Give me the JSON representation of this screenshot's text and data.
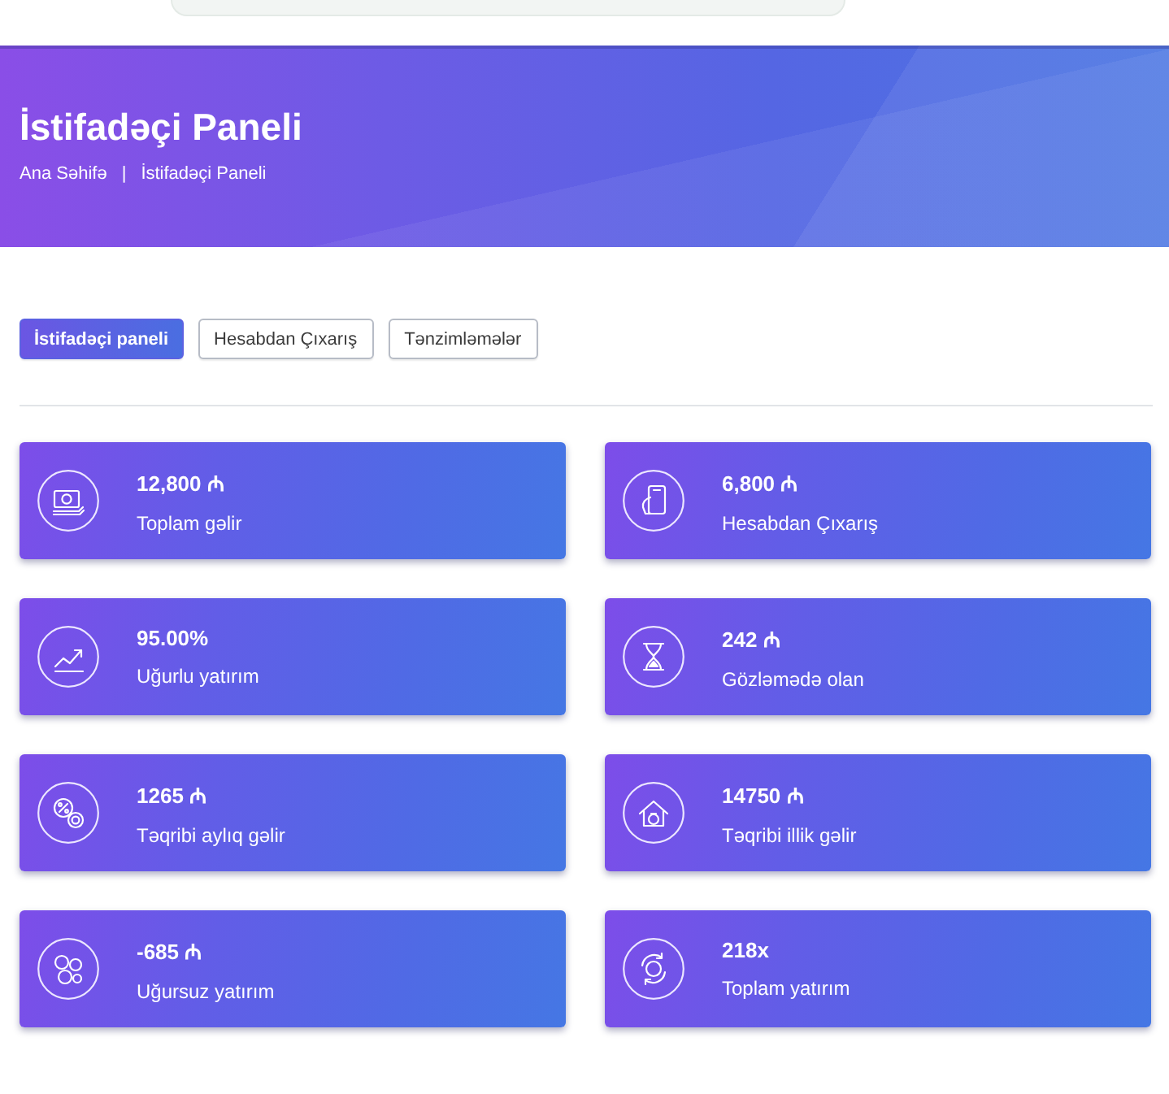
{
  "header": {
    "title": "İstifadəçi Paneli",
    "breadcrumb": [
      "Ana Səhifə",
      "İstifadəçi Paneli"
    ],
    "separator": "|"
  },
  "tabs": [
    {
      "label": "İstifadəçi paneli",
      "selected": true
    },
    {
      "label": "Hesabdan Çıxarış",
      "selected": false
    },
    {
      "label": "Tənzimləmələr",
      "selected": false
    }
  ],
  "stats": [
    {
      "kind": "banknote",
      "value": "12,800 ₼",
      "label": "Toplam gəlir"
    },
    {
      "kind": "phone",
      "value": "6,800 ₼",
      "label": "Hesabdan Çıxarış"
    },
    {
      "kind": "trend",
      "value": "95.00%",
      "label": "Uğurlu yatırım"
    },
    {
      "kind": "hourglass",
      "value": "242 ₼",
      "label": "Gözləmədə olan"
    },
    {
      "kind": "percent",
      "value": "1265 ₼",
      "label": "Təqribi aylıq gəlir"
    },
    {
      "kind": "house",
      "value": "14750 ₼",
      "label": "Təqribi illik gəlir"
    },
    {
      "kind": "coins",
      "value": "-685 ₼",
      "label": "Uğursuz yatırım"
    },
    {
      "kind": "cycle",
      "value": "218x",
      "label": "Toplam yatırım"
    }
  ]
}
